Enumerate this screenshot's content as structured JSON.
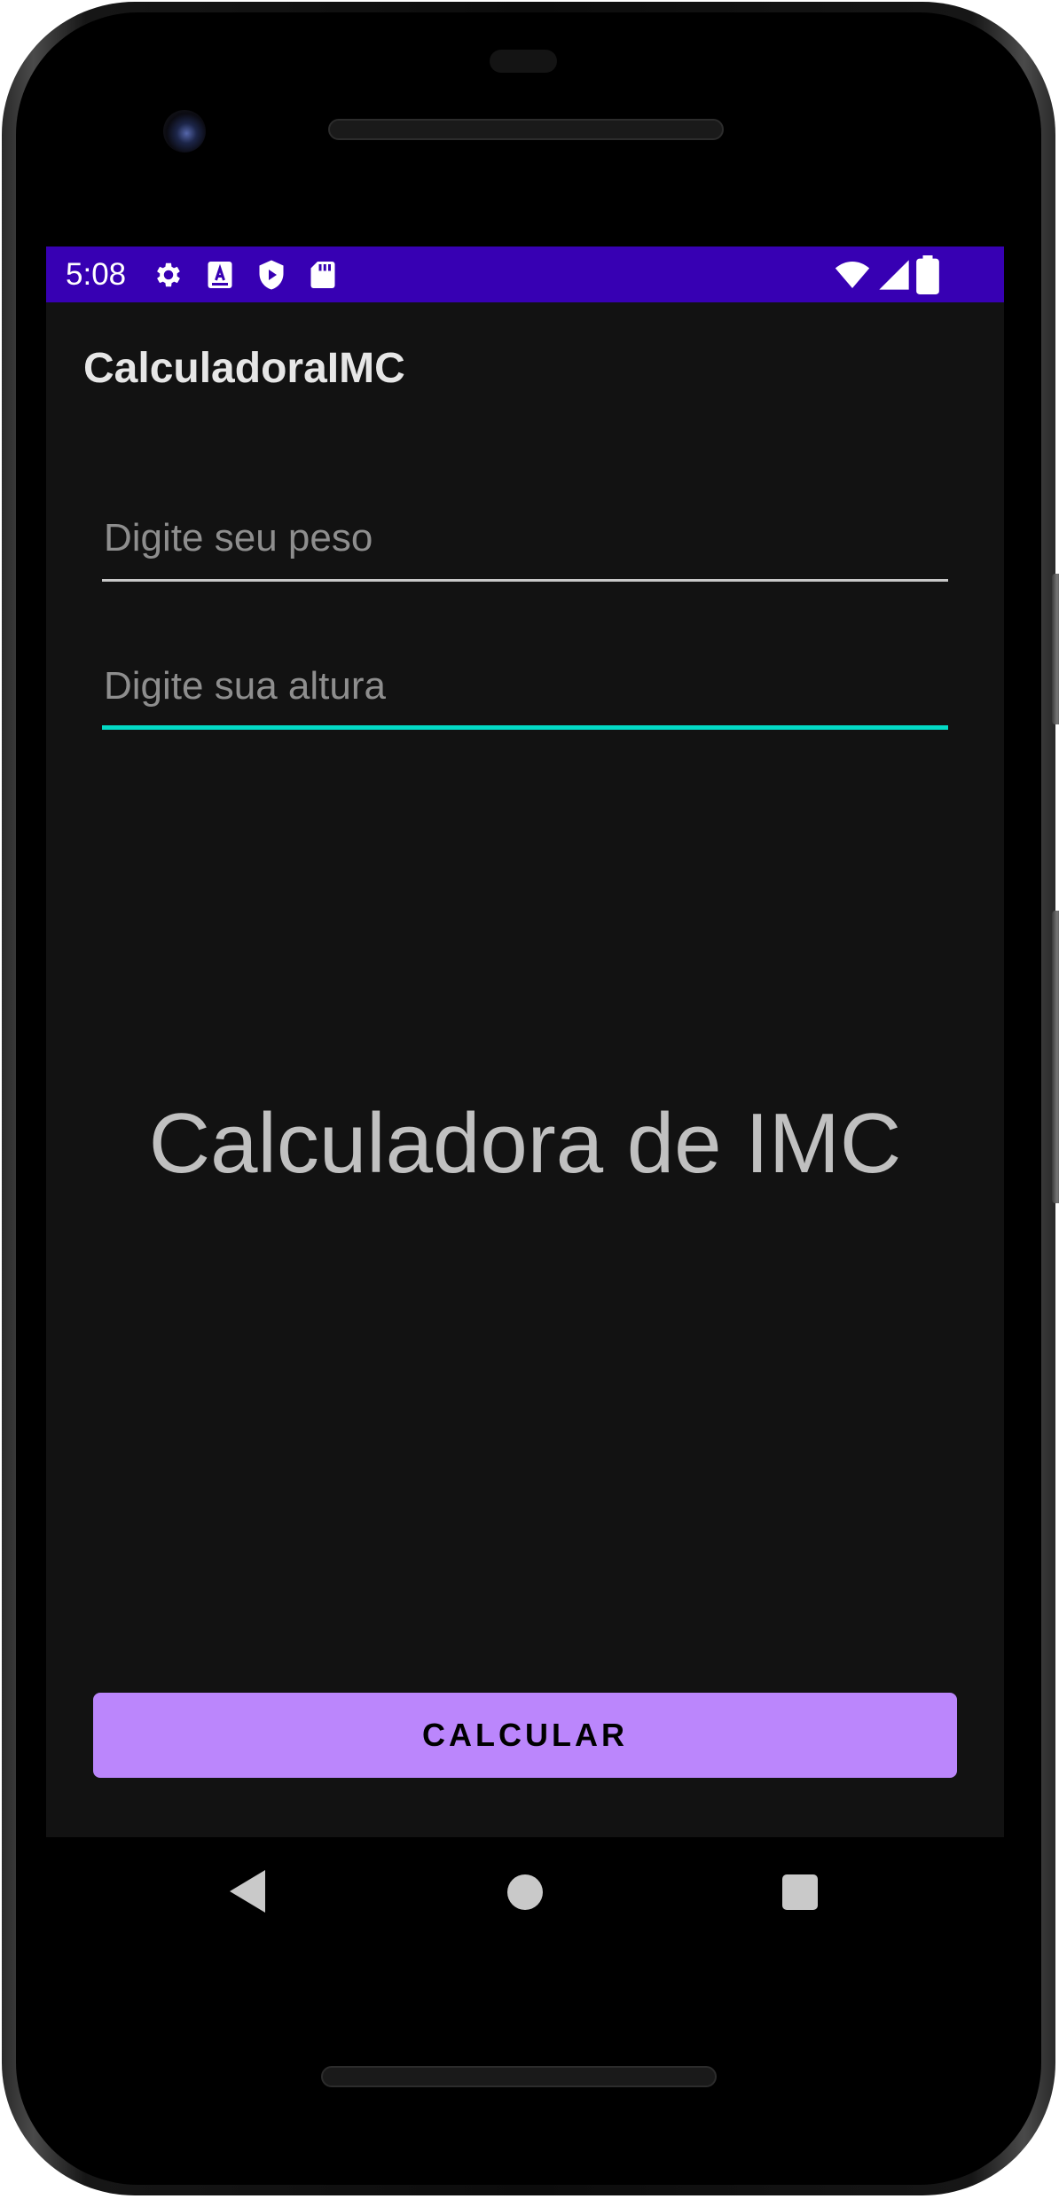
{
  "status_bar": {
    "time": "5:08",
    "background_color": "#3700b3",
    "left_icons": [
      "settings-icon",
      "keyboard-a-icon",
      "shield-play-icon",
      "sd-card-icon"
    ],
    "right_icons": [
      "wifi-icon",
      "cell-signal-icon",
      "battery-icon"
    ]
  },
  "app_bar": {
    "title": "CalculadoraIMC"
  },
  "form": {
    "weight_placeholder": "Digite seu peso",
    "height_placeholder": "Digite sua altura",
    "focused_field": "height",
    "accent_color": "#03dac5"
  },
  "result": {
    "text": "Calculadora de IMC"
  },
  "actions": {
    "calculate_label": "CALCULAR",
    "button_color": "#bb86fc"
  },
  "navigation": {
    "buttons": [
      "back-icon",
      "home-icon",
      "recents-icon"
    ]
  },
  "theme": {
    "screen_background": "#121212"
  }
}
